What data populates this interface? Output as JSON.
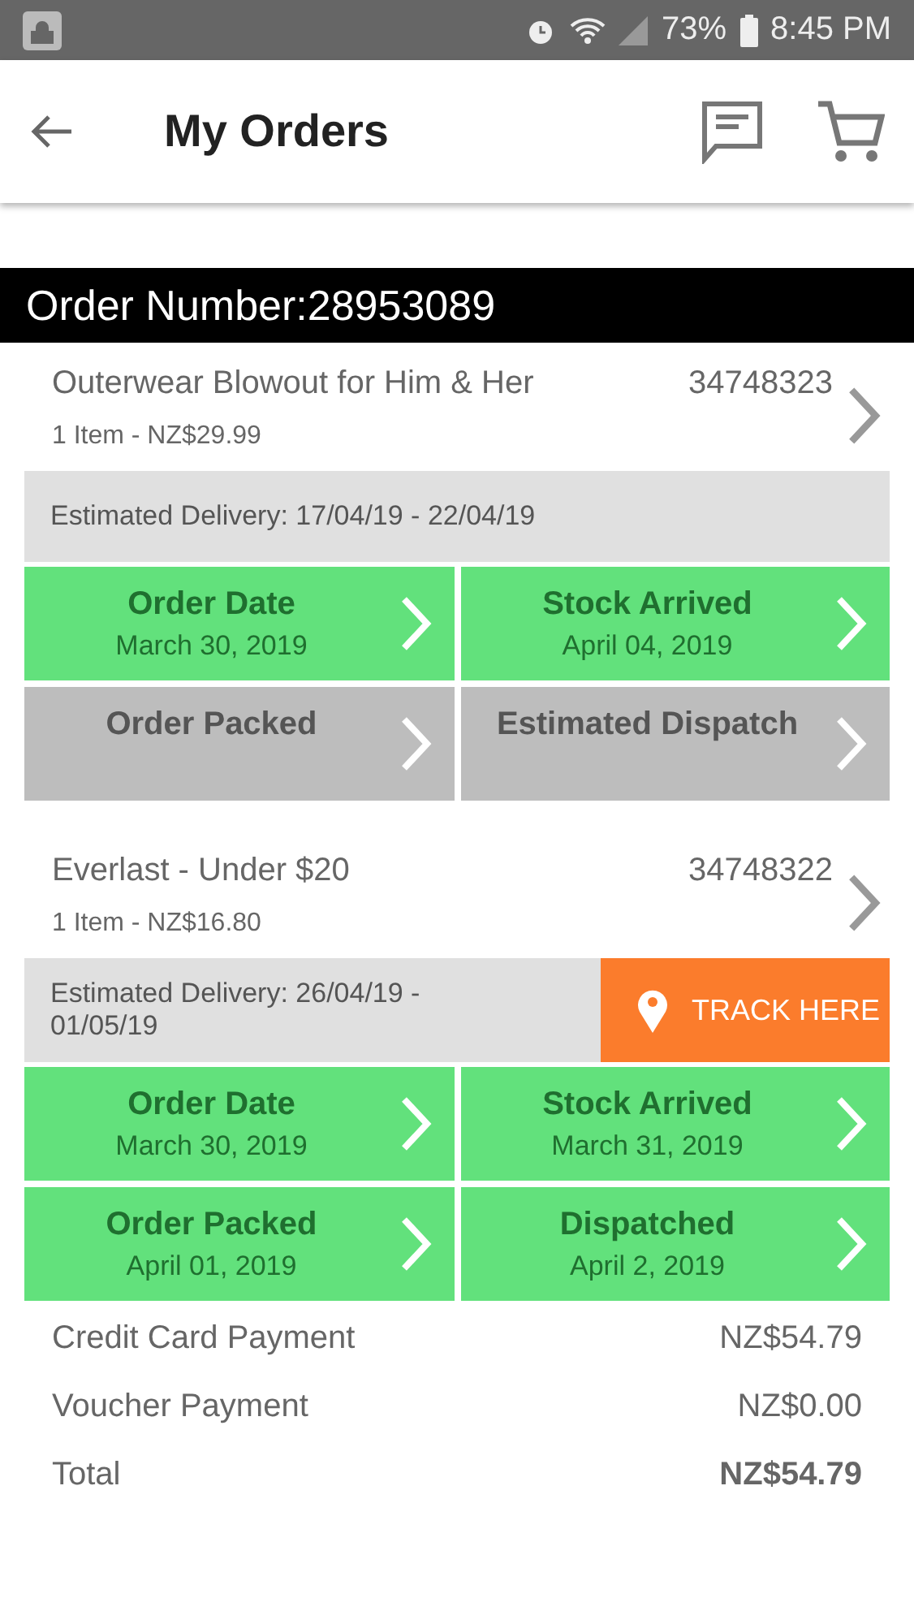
{
  "status_bar": {
    "battery": "73%",
    "time": "8:45 PM"
  },
  "app_bar": {
    "title": "My Orders"
  },
  "order": {
    "number_label": "Order Number:28953089",
    "items": [
      {
        "name": "Outerwear Blowout for Him & Her",
        "code": "34748323",
        "summary": "1 Item - NZ$29.99",
        "delivery": "Estimated Delivery: 17/04/19 - 22/04/19",
        "stages": [
          {
            "label": "Order Date",
            "date": "March 30, 2019",
            "done": true
          },
          {
            "label": "Stock Arrived",
            "date": "April 04, 2019",
            "done": true
          },
          {
            "label": "Order Packed",
            "done": false
          },
          {
            "label": "Estimated Dispatch",
            "done": false
          }
        ]
      },
      {
        "name": "Everlast - Under $20",
        "code": "34748322",
        "summary": "1 Item - NZ$16.80",
        "delivery": "Estimated Delivery: 26/04/19 - 01/05/19",
        "track_button": "TRACK HERE",
        "stages": [
          {
            "label": "Order Date",
            "date": "March 30, 2019",
            "done": true
          },
          {
            "label": "Stock Arrived",
            "date": "March 31, 2019",
            "done": true
          },
          {
            "label": "Order Packed",
            "date": "April 01, 2019",
            "done": true
          },
          {
            "label": "Dispatched",
            "date": "April 2, 2019",
            "done": true
          }
        ]
      }
    ],
    "payments": [
      {
        "label": "Credit Card Payment",
        "amount": "NZ$54.79",
        "kind": "line"
      },
      {
        "label": "Voucher Payment",
        "amount": "NZ$0.00",
        "kind": "line"
      },
      {
        "label": "Total",
        "amount": "NZ$54.79",
        "kind": "total"
      }
    ]
  }
}
